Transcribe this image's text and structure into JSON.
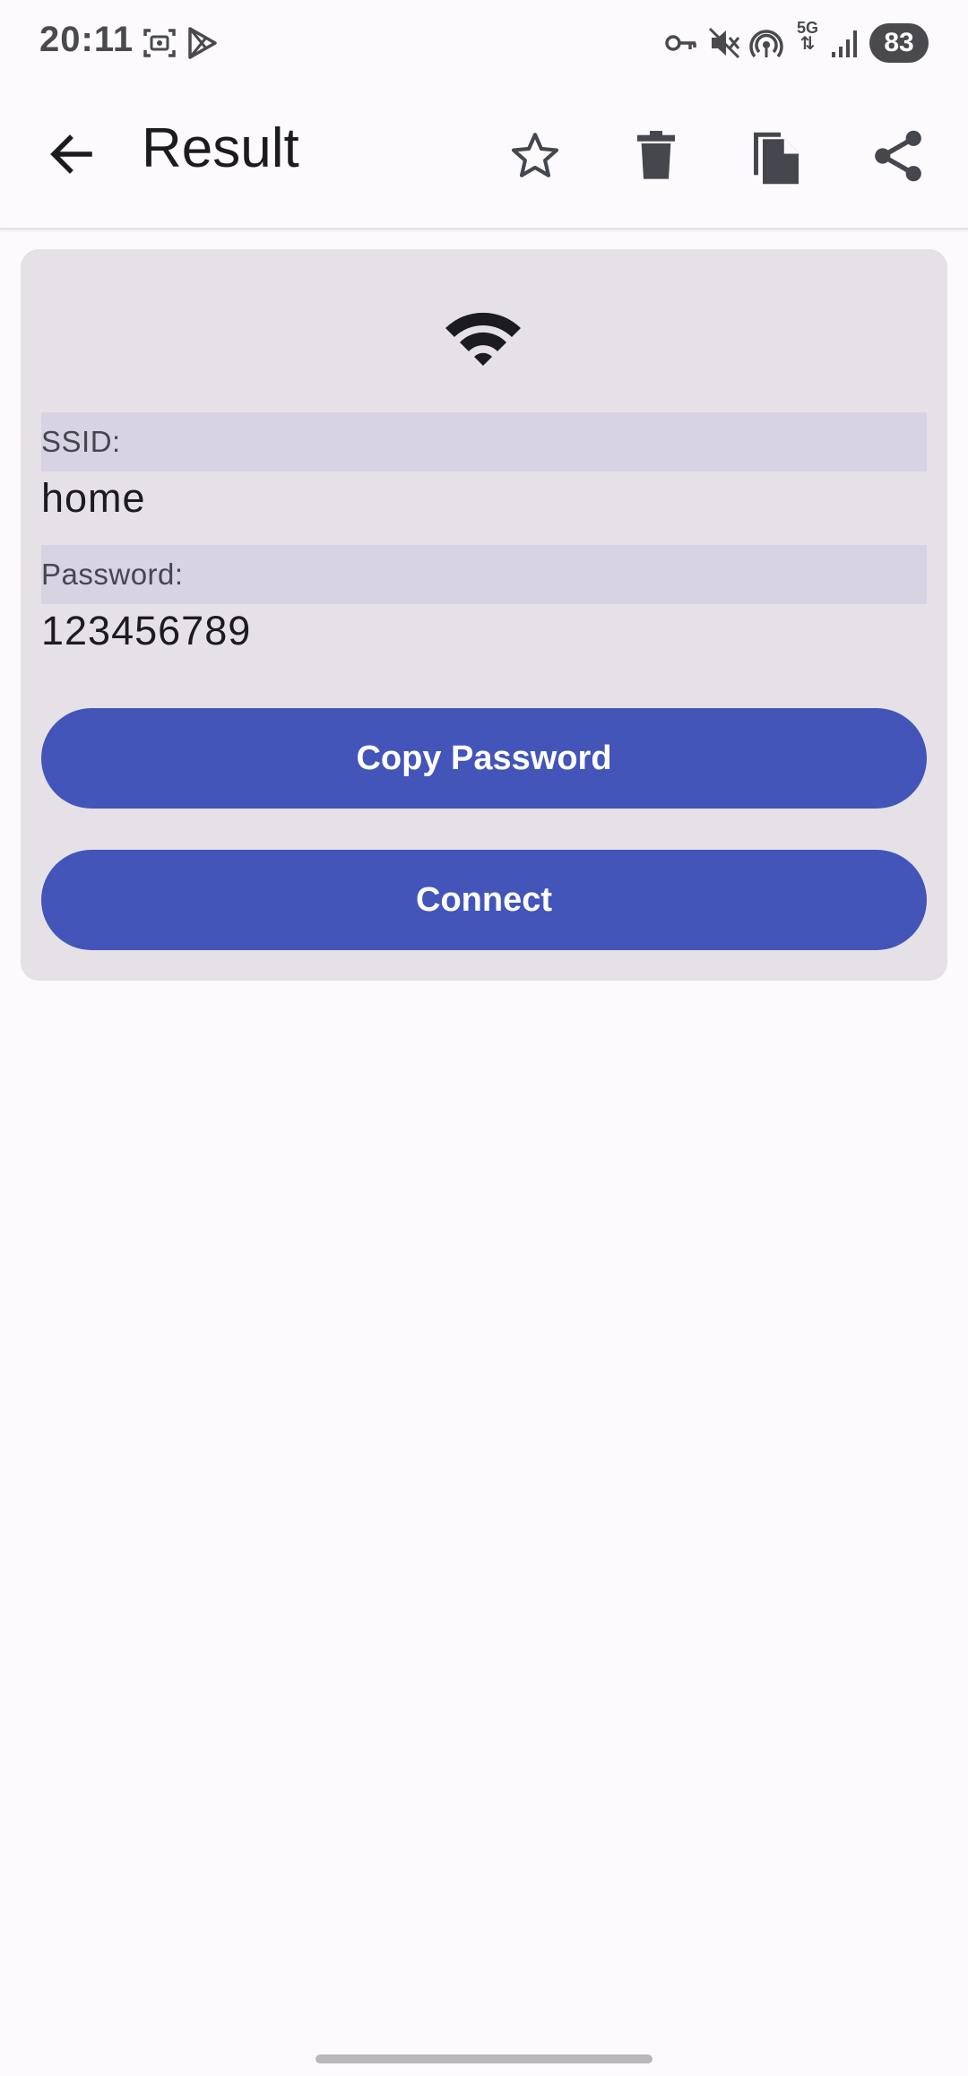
{
  "status_bar": {
    "time": "20:11",
    "battery": "83",
    "network": "5G"
  },
  "app_bar": {
    "title": "Result",
    "actions": [
      "favorite",
      "delete",
      "copy",
      "share"
    ]
  },
  "wifi_result": {
    "ssid_label": "SSID:",
    "ssid_value": "home",
    "password_label": "Password:",
    "password_value": "123456789",
    "copy_button": "Copy Password",
    "connect_button": "Connect"
  },
  "colors": {
    "accent": "#4355B9",
    "card": "#E5E1E6",
    "label_band": "#D8D3E3",
    "background": "#FCFAFD"
  }
}
